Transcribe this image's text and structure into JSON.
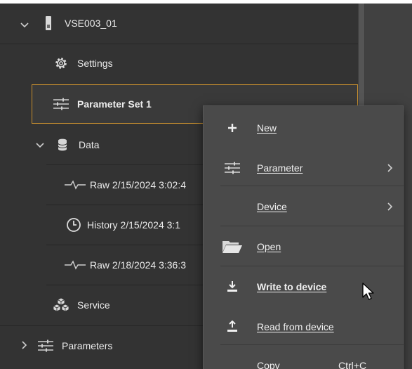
{
  "tree": {
    "device": {
      "label": "VSE003_01",
      "icon": "device-icon",
      "expanded": true
    },
    "settings": {
      "label": "Settings",
      "icon": "gear-icon"
    },
    "parameter_set": {
      "label": "Parameter Set 1",
      "icon": "sliders-icon",
      "selected": true
    },
    "data": {
      "label": "Data",
      "icon": "database-icon",
      "expanded": true
    },
    "data_items": [
      {
        "label": "Raw 2/15/2024 3:02:4",
        "icon": "waveform-icon"
      },
      {
        "label": "History 2/15/2024 3:1",
        "icon": "clock-icon"
      },
      {
        "label": "Raw 2/18/2024 3:36:3",
        "icon": "waveform-icon"
      }
    ],
    "service": {
      "label": "Service",
      "icon": "cubes-icon"
    },
    "parameters": {
      "label": "Parameters",
      "icon": "sliders-icon",
      "expanded": false
    }
  },
  "context_menu": {
    "items": [
      {
        "label": "New",
        "icon": "plus-icon"
      },
      {
        "label": "Parameter",
        "icon": "sliders-icon",
        "submenu": true
      },
      {
        "label": "Device",
        "submenu": true
      },
      {
        "label": "Open",
        "icon": "folder-open-icon"
      },
      {
        "label": "Write to device",
        "icon": "download-icon",
        "hovered": true
      },
      {
        "label": "Read from device",
        "icon": "upload-icon"
      },
      {
        "label": "Copy",
        "shortcut": "Ctrl+C"
      }
    ]
  },
  "colors": {
    "tree_bg": "#333333",
    "menu_bg": "#4a4a4a",
    "selection_border": "#c8902f",
    "text": "#ececec"
  }
}
